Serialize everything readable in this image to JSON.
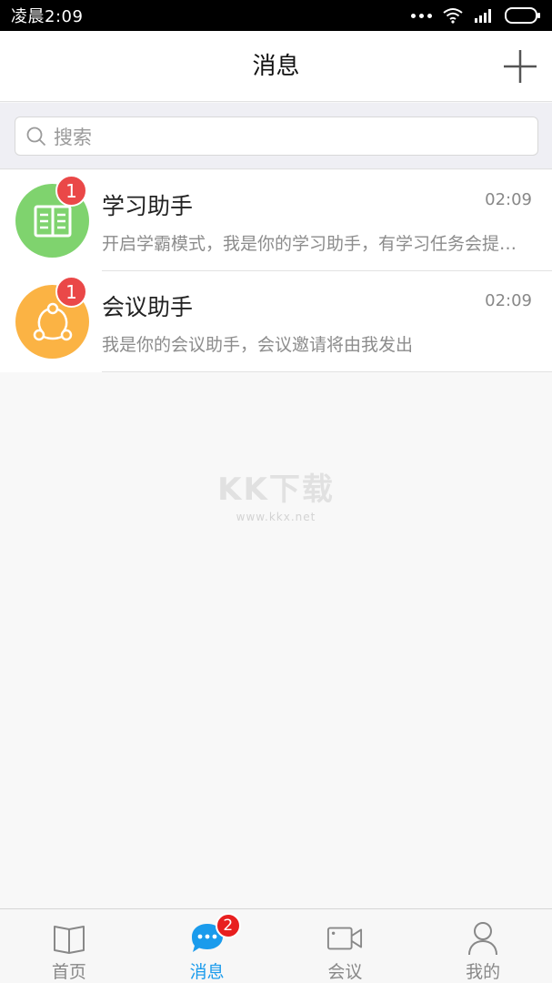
{
  "status_bar": {
    "time": "凌晨2:09"
  },
  "header": {
    "title": "消息"
  },
  "search": {
    "placeholder": "搜索"
  },
  "conversations": [
    {
      "name": "学习助手",
      "time": "02:09",
      "preview": "开启学霸模式，我是你的学习助手，有学习任务会提醒你哦",
      "badge": "1",
      "color": "#7fd36e",
      "icon": "book-icon"
    },
    {
      "name": "会议助手",
      "time": "02:09",
      "preview": "我是你的会议助手，会议邀请将由我发出",
      "badge": "1",
      "color": "#fbb344",
      "icon": "share-network-icon"
    }
  ],
  "watermark": {
    "main": "KK下载",
    "url": "www.kkx.net"
  },
  "tabs": [
    {
      "label": "首页",
      "icon": "book-open-icon",
      "active": false
    },
    {
      "label": "消息",
      "icon": "chat-bubble-icon",
      "active": true,
      "badge": "2"
    },
    {
      "label": "会议",
      "icon": "video-camera-icon",
      "active": false
    },
    {
      "label": "我的",
      "icon": "person-icon",
      "active": false
    }
  ],
  "colors": {
    "accent": "#1a9bec",
    "badge": "#ea4848"
  }
}
